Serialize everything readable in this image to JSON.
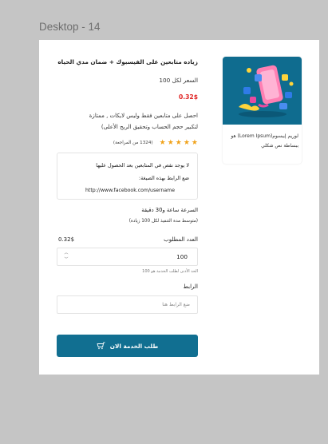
{
  "frame": {
    "title": "Desktop - 14"
  },
  "service": {
    "title": "زياده متابعين على الفيسبوك + ضمان مدي الحياه",
    "price_per": "السعر لكل 100",
    "price": "0.32$",
    "description_line1": "احصل على متابعين فقط وليس لايكات , ممتازة",
    "description_line2": "لتكبير حجم الحساب وتحقيق الربح الأعلى)",
    "rating": {
      "stars": 5,
      "reviews": "(1324 من المراجعة)"
    }
  },
  "notes": {
    "line1": "لا يوجد نقص في المتابعين بعد الحصول عليها",
    "line2": "ضع الرابط بهذه الصيغة:",
    "link": "http://www.facebook.com/username"
  },
  "speed": {
    "text": "السرعة ساعة و30 دقيقة",
    "note": "(متوسط مدة التنفيذ لكل 100 زيادة)"
  },
  "quantity": {
    "label": "العدد المطلوب",
    "price": "0.32$",
    "value": "100",
    "min_note": "الحد الأدنى لطلب الخدمة هو 100"
  },
  "link_field": {
    "label": "الرابط",
    "placeholder": "ضع الرابط هنا"
  },
  "order_button": {
    "label": "طلب الخدمة الان",
    "icon": "cart-icon"
  },
  "product_card": {
    "text_line1": "لوريم إيبسوم(Lorem Ipsum) هو",
    "text_line2": "ببساطة نص شكلي"
  },
  "colors": {
    "accent": "#116f91",
    "price": "#e02424",
    "star": "#f0a21a"
  }
}
